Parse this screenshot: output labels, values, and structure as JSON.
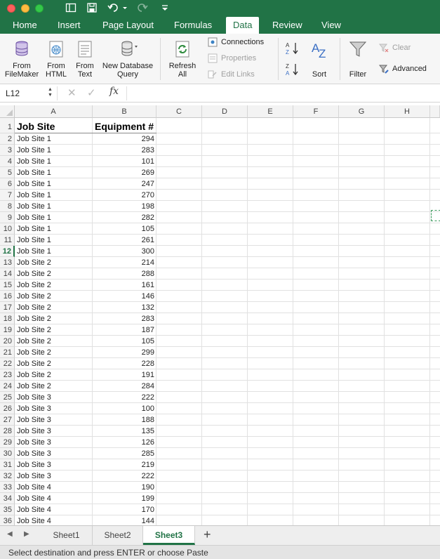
{
  "ribbon_tabs": [
    "Home",
    "Insert",
    "Page Layout",
    "Formulas",
    "Data",
    "Review",
    "View"
  ],
  "ribbon": {
    "from_filemaker": [
      "From",
      "FileMaker"
    ],
    "from_html": [
      "From",
      "HTML"
    ],
    "from_text": [
      "From",
      "Text"
    ],
    "new_db_query": [
      "New Database",
      "Query"
    ],
    "refresh_all": [
      "Refresh",
      "All"
    ],
    "connections": "Connections",
    "properties": "Properties",
    "edit_links": "Edit Links",
    "sort": "Sort",
    "filter": "Filter",
    "clear": "Clear",
    "advanced": "Advanced"
  },
  "formula_bar": {
    "name_box": "L12",
    "fx_label": "fx",
    "formula": ""
  },
  "columns": [
    "A",
    "B",
    "C",
    "D",
    "E",
    "F",
    "G",
    "H"
  ],
  "selected_row": 12,
  "sheet": {
    "header": [
      "Job Site",
      "Equipment #"
    ],
    "rows": [
      [
        "Job Site 1",
        "294"
      ],
      [
        "Job Site 1",
        "283"
      ],
      [
        "Job Site 1",
        "101"
      ],
      [
        "Job Site 1",
        "269"
      ],
      [
        "Job Site 1",
        "247"
      ],
      [
        "Job Site 1",
        "270"
      ],
      [
        "Job Site 1",
        "198"
      ],
      [
        "Job Site 1",
        "282"
      ],
      [
        "Job Site 1",
        "105"
      ],
      [
        "Job Site 1",
        "261"
      ],
      [
        "Job Site 1",
        "300"
      ],
      [
        "Job Site 2",
        "214"
      ],
      [
        "Job Site 2",
        "288"
      ],
      [
        "Job Site 2",
        "161"
      ],
      [
        "Job Site 2",
        "146"
      ],
      [
        "Job Site 2",
        "132"
      ],
      [
        "Job Site 2",
        "283"
      ],
      [
        "Job Site 2",
        "187"
      ],
      [
        "Job Site 2",
        "105"
      ],
      [
        "Job Site 2",
        "299"
      ],
      [
        "Job Site 2",
        "228"
      ],
      [
        "Job Site 2",
        "191"
      ],
      [
        "Job Site 2",
        "284"
      ],
      [
        "Job Site 3",
        "222"
      ],
      [
        "Job Site 3",
        "100"
      ],
      [
        "Job Site 3",
        "188"
      ],
      [
        "Job Site 3",
        "135"
      ],
      [
        "Job Site 3",
        "126"
      ],
      [
        "Job Site 3",
        "285"
      ],
      [
        "Job Site 3",
        "219"
      ],
      [
        "Job Site 3",
        "222"
      ],
      [
        "Job Site 4",
        "190"
      ],
      [
        "Job Site 4",
        "199"
      ],
      [
        "Job Site 4",
        "170"
      ],
      [
        "Job Site 4",
        "144"
      ]
    ]
  },
  "sheet_tabs": [
    "Sheet1",
    "Sheet2",
    "Sheet3"
  ],
  "active_sheet": "Sheet3",
  "status_text": "Select destination and press ENTER or choose Paste",
  "colors": {
    "accent": "#217346",
    "title_bar": "#217346"
  }
}
